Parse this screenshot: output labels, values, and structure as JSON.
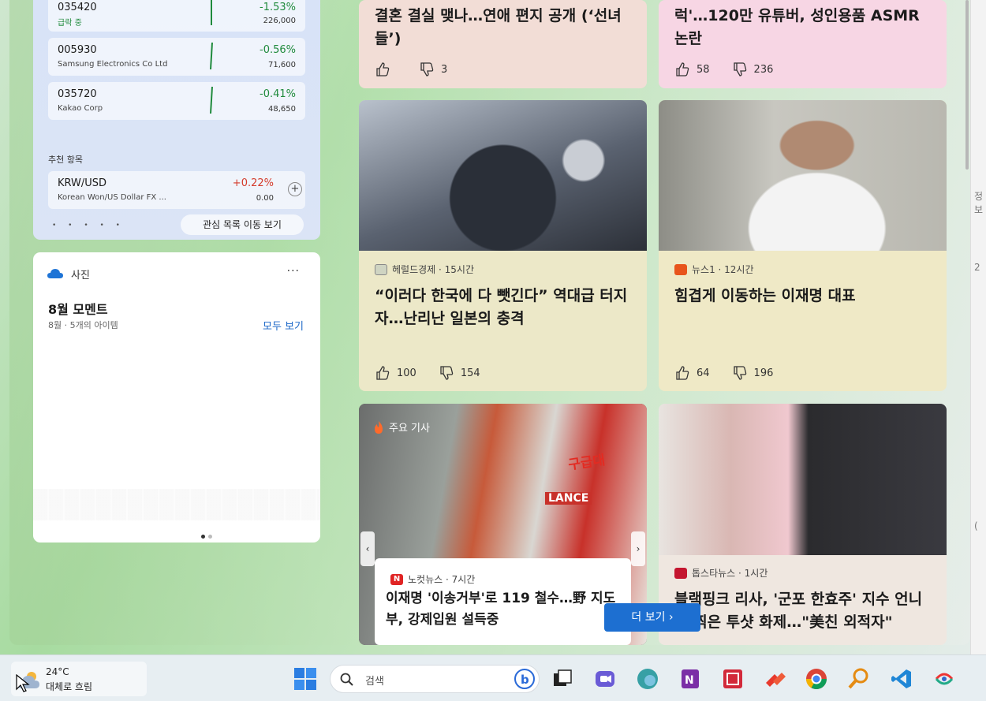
{
  "finance": {
    "stocks": [
      {
        "code": "035420",
        "name": "급락 중",
        "change": "-1.53%",
        "price": "226,000"
      },
      {
        "code": "005930",
        "name": "Samsung Electronics Co Ltd",
        "change": "-0.56%",
        "price": "71,600"
      },
      {
        "code": "035720",
        "name": "Kakao Corp",
        "change": "-0.41%",
        "price": "48,650"
      }
    ],
    "recommended_title": "추천 항목",
    "recommended": {
      "code": "KRW/USD",
      "name": "Korean Won/US Dollar FX ...",
      "change": "+0.22%",
      "price": "0.00",
      "add": "+"
    },
    "watchlist_button": "관심 목록 이동 보기",
    "page_dots": "• • • • •"
  },
  "photos": {
    "header": "사진",
    "more": "···",
    "title": "8월 모멘트",
    "subtitle": "8월 · 5개의 아이템",
    "see_all": "모두 보기"
  },
  "news": [
    {
      "title": "결혼 결실 맺나…연애 편지 공개 (‘선녀들’)",
      "likes": "",
      "dislikes": "3"
    },
    {
      "title": "럭'…120만 유튜버, 성인용품 ASMR 논란",
      "likes": "58",
      "dislikes": "236"
    },
    {
      "source": "헤럴드경제 · 15시간",
      "title": "“이러다 한국에 다 뺏긴다” 역대급 터지자…난리난 일본의 충격",
      "likes": "100",
      "dislikes": "154"
    },
    {
      "source": "뉴스1 · 12시간",
      "title": "힘겹게 이동하는 이재명 대표",
      "likes": "64",
      "dislikes": "196"
    },
    {
      "tag": "주요 기사",
      "source": "노컷뉴스 · 7시간",
      "title": "이재명 '이송거부'로 119 철수…野 지도부, 강제입원 설득중",
      "photo_text_1": "구급대",
      "photo_text_2": "LANCE"
    },
    {
      "source": "톱스타뉴스 · 1시간",
      "title": "블랙핑크 리사, '군포 한효주' 지수 언니와 찍은 투샷 화제…\"美친 외적자\""
    }
  ],
  "more_button": "더 보기 ›",
  "taskbar": {
    "temperature": "24°C",
    "condition": "대체로 흐림",
    "search_placeholder": "검색"
  },
  "right_strip": [
    "정보",
    "2",
    "("
  ],
  "colors": {
    "accent": "#1d6fd1",
    "negative": "#1f8a3c",
    "positive": "#d43b2b"
  }
}
